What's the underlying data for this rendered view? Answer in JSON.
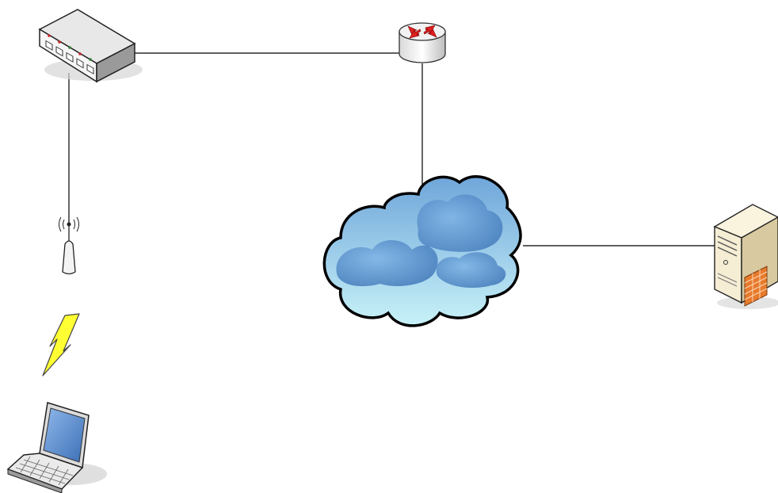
{
  "diagram": {
    "nodes": [
      {
        "id": "switch",
        "icon": "network-switch-icon"
      },
      {
        "id": "router",
        "icon": "router-icon"
      },
      {
        "id": "access-point",
        "icon": "wireless-access-point-icon"
      },
      {
        "id": "wireless-link",
        "icon": "lightning-bolt-icon"
      },
      {
        "id": "laptop",
        "icon": "laptop-icon"
      },
      {
        "id": "cloud",
        "icon": "internet-cloud-icon"
      },
      {
        "id": "server",
        "icon": "server-firewall-icon"
      }
    ],
    "links": [
      {
        "from": "switch",
        "to": "router",
        "style": "wired"
      },
      {
        "from": "switch",
        "to": "access-point",
        "style": "wired"
      },
      {
        "from": "router",
        "to": "cloud",
        "style": "wired"
      },
      {
        "from": "cloud",
        "to": "server",
        "style": "wired"
      },
      {
        "from": "access-point",
        "to": "laptop",
        "style": "wireless"
      }
    ],
    "colors": {
      "cloud_light": "#c8f2f8",
      "cloud_dark": "#4f86c6",
      "router_arrows": "#e02020",
      "bolt": "#ffff33",
      "server_body": "#f3e8c8",
      "firewall": "#e87a2c",
      "laptop_screen": "#5f8fd0",
      "device_gray": "#cfcfcf"
    }
  }
}
